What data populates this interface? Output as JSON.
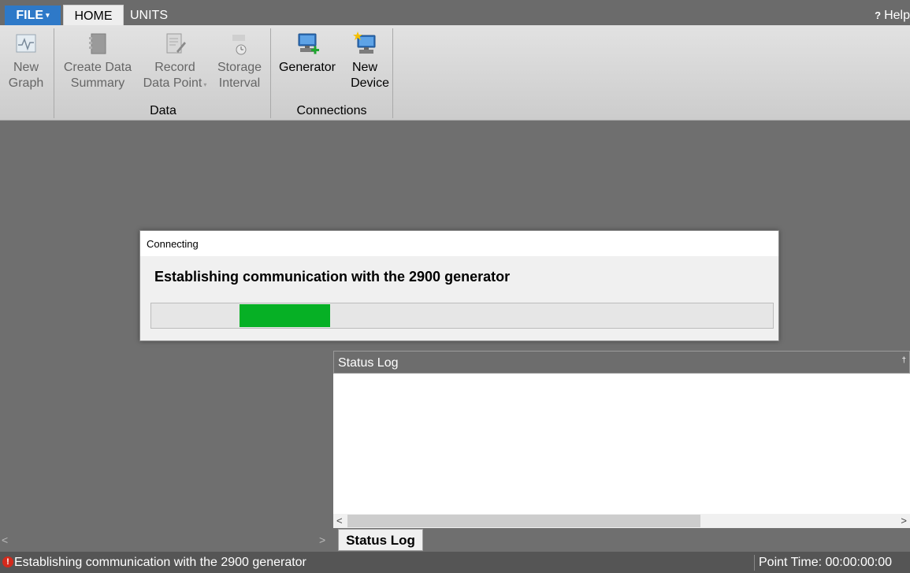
{
  "tabs": {
    "file": "FILE",
    "home": "HOME",
    "units": "UNITS",
    "help_icon": "?",
    "help": "Help"
  },
  "ribbon": {
    "new_graph": [
      "New",
      "Graph"
    ],
    "create_data_summary": [
      "Create Data",
      "Summary"
    ],
    "record_data_point": [
      "Record",
      "Data Point"
    ],
    "storage_interval": [
      "Storage",
      "Interval"
    ],
    "generator": "Generator",
    "new_device": [
      "New",
      "Device"
    ],
    "group_data": "Data",
    "group_connections": "Connections"
  },
  "dialog": {
    "title": "Connecting",
    "message": "Establishing communication with the 2900 generator",
    "progress_fill_color": "#06b025"
  },
  "status_log": {
    "title": "Status Log",
    "pin_icon": "pin-icon",
    "tab_label": "Status Log"
  },
  "statusbar": {
    "message": "Establishing communication with the 2900 generator",
    "point_time": "Point Time: 00:00:00:00"
  },
  "colors": {
    "file_tab": "#2e79c8",
    "workspace": "#6f6f6f",
    "statusbar": "#555555"
  }
}
